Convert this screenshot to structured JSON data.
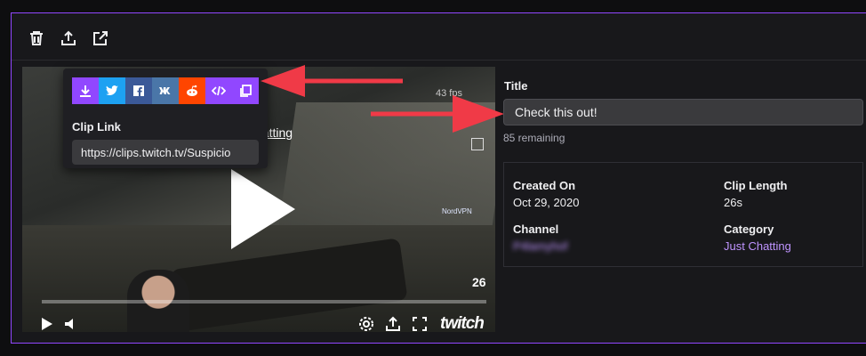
{
  "toolbar": {
    "icons": [
      "trash-icon",
      "upload-icon",
      "external-link-icon"
    ]
  },
  "player": {
    "video_title_fragment": "hatting",
    "hud_text": "43 fps",
    "sponsor_text": "NordVPN",
    "duration": "26",
    "brand": "twitch"
  },
  "share": {
    "buttons": [
      "download",
      "twitter",
      "facebook",
      "vk",
      "reddit",
      "embed",
      "copy"
    ],
    "colors": {
      "download": "#9147ff",
      "twitter": "#1da1f2",
      "facebook": "#3b5998",
      "vk": "#4a76a8",
      "reddit": "#ff4500",
      "embed": "#9147ff",
      "copy": "#9147ff"
    },
    "clip_link_label": "Clip Link",
    "clip_link_value": "https://clips.twitch.tv/Suspicio"
  },
  "details": {
    "title_label": "Title",
    "title_value": "Check this out!",
    "remaining": "85 remaining",
    "created_on_label": "Created On",
    "created_on_value": "Oct 29, 2020",
    "clip_length_label": "Clip Length",
    "clip_length_value": "26s",
    "channel_label": "Channel",
    "channel_value": "P4lamyhof",
    "category_label": "Category",
    "category_value": "Just Chatting"
  },
  "colors": {
    "accent": "#9147ff",
    "arrow": "#f03a47",
    "link": "#bf94ff"
  }
}
